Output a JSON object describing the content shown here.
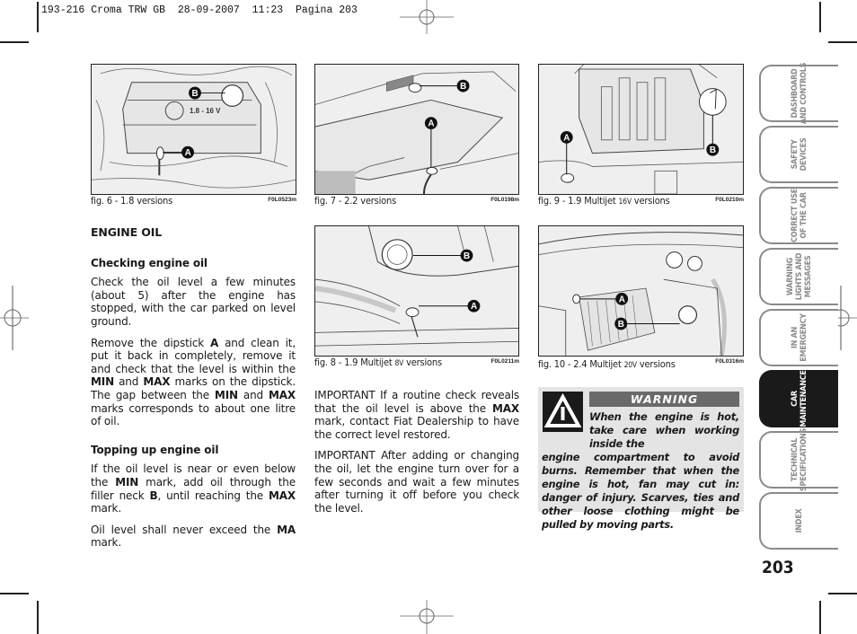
{
  "slug": "193-216 Croma TRW GB  28-09-2007  11:23  Pagina 203",
  "figures": [
    {
      "id": "fig6",
      "caption": "fig. 6 - 1.8 versions",
      "caption_small": "",
      "caption_suffix": "",
      "code": "F0L0523m",
      "label_a": "A",
      "label_b": "B",
      "engine_badge": "1.8 - 16 V"
    },
    {
      "id": "fig7",
      "caption": "fig. 7 - 2.2 versions",
      "caption_small": "",
      "caption_suffix": "",
      "code": "F0L0198m",
      "label_a": "A",
      "label_b": "B"
    },
    {
      "id": "fig9",
      "caption": "fig. 9 - 1.9 Multijet ",
      "caption_small": "16V",
      "caption_suffix": " versions",
      "code": "F0L0210m",
      "label_a": "A",
      "label_b": "B"
    },
    {
      "id": "fig8",
      "caption": "fig. 8 - 1.9 Multijet ",
      "caption_small": "8V",
      "caption_suffix": " versions",
      "code": "F0L0211m",
      "label_a": "A",
      "label_b": "B"
    },
    {
      "id": "fig10",
      "caption": "fig. 10 - 2.4 Multijet ",
      "caption_small": "20V",
      "caption_suffix": " versions",
      "code": "F0L0316m",
      "label_a": "A",
      "label_b": "B"
    }
  ],
  "left_column": {
    "heading": "ENGINE OIL",
    "subheading_check": "Checking engine oil",
    "para1": "Check the oil level a few minutes (about 5) after the engine has stopped, with the car parked on level ground.",
    "para2": {
      "t1": "Remove the dipstick ",
      "b1": "A",
      "t2": " and clean it, put it back in completely, remove it and check that the level is within the ",
      "b2": "MIN",
      "t3": " and ",
      "b3": "MAX",
      "t4": " marks on the dipstick. The gap between the ",
      "b4": "MIN",
      "t5": " and ",
      "b5": "MAX",
      "t6": " marks corresponds to about one litre of oil."
    },
    "subheading_top": "Topping up engine oil",
    "para3": {
      "t1": "If the oil level is near or even below the ",
      "b1": "MIN",
      "t2": " mark, add oil through the filler neck ",
      "b2": "B",
      "t3": ", until reaching the ",
      "b3": "MAX",
      "t4": " mark."
    },
    "para4": {
      "t1": "Oil level shall never exceed the ",
      "b1": "MA",
      "t2": " mark."
    }
  },
  "middle_column": {
    "important1": {
      "t1": "IMPORTANT If a routine check reveals that the oil level is above the ",
      "b1": "MAX",
      "t2": " mark, contact Fiat Dealership to have the correct level restored."
    },
    "important2": "IMPORTANT After adding or changing the oil, let the engine turn over for a few seconds and wait a few minutes after turning it off before you check the level."
  },
  "warning": {
    "title": "WARNING",
    "icon": "warning-triangle-icon",
    "text_indent": "When the engine is hot, take care when working inside the",
    "text_rest": "engine compartment to avoid burns. Remember that when the engine is hot, fan may cut in: danger of injury. Scarves, ties and other loose clothing might be pulled by moving parts."
  },
  "tabs": [
    {
      "label": "DASHBOARD\nAND CONTROLS",
      "active": false
    },
    {
      "label": "SAFETY\nDEVICES",
      "active": false
    },
    {
      "label": "CORRECT USE\nOF THE CAR",
      "active": false
    },
    {
      "label": "WARNING\nLIGHTS AND\nMESSAGES",
      "active": false
    },
    {
      "label": "IN AN\nEMERGENCY",
      "active": false
    },
    {
      "label": "CAR\nMAINTENANCE",
      "active": true
    },
    {
      "label": "TECHNICAL\nSPECIFICATIONS",
      "active": false
    },
    {
      "label": "INDEX",
      "active": false
    }
  ],
  "page_number": "203",
  "colors": {
    "tab_border": "#8a8a8a",
    "tab_active": "#1a1a1a",
    "warning_bg": "#e4e4e4",
    "warning_title_bg": "#6a6a6a"
  }
}
